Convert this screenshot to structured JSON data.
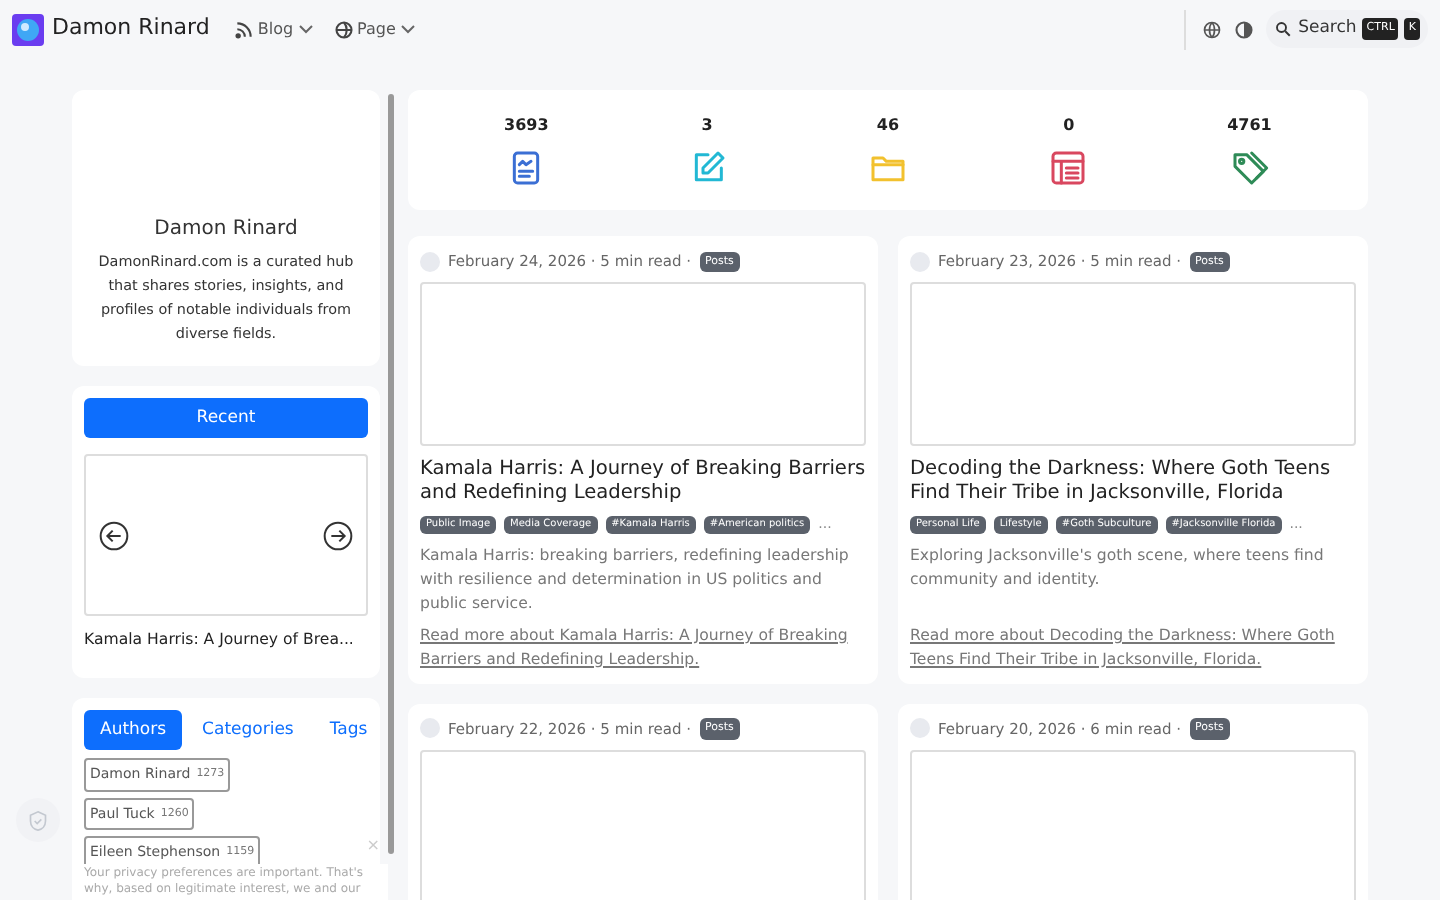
{
  "header": {
    "site_title": "Damon Rinard",
    "nav": [
      {
        "label": "Blog",
        "kind": "blog"
      },
      {
        "label": "Page",
        "kind": "page"
      }
    ],
    "search": {
      "label": "Search",
      "keys": [
        "CTRL",
        "K"
      ]
    }
  },
  "profile": {
    "name": "Damon Rinard",
    "description": "DamonRinard.com is a curated hub that shares stories, insights, and profiles of notable individuals from diverse fields."
  },
  "recent": {
    "button": "Recent",
    "slide_title": "Kamala Harris: A Journey of Brea..."
  },
  "taxonomy": {
    "tabs": [
      {
        "label": "Authors",
        "selected": true
      },
      {
        "label": "Categories",
        "selected": false
      },
      {
        "label": "Tags",
        "selected": false
      }
    ],
    "authors": [
      {
        "name": "Damon Rinard",
        "count": "1273"
      },
      {
        "name": "Paul Tuck",
        "count": "1260"
      },
      {
        "name": "Eileen Stephenson",
        "count": "1159"
      }
    ]
  },
  "privacy_notice": {
    "text": "Your privacy preferences are important. That's why, based on legitimate interest, we and our",
    "close": "×"
  },
  "stats": [
    {
      "value": "3693",
      "kind": "posts",
      "color": "#3b6fd4"
    },
    {
      "value": "3",
      "kind": "edit",
      "color": "#22b8d4"
    },
    {
      "value": "46",
      "kind": "folder",
      "color": "#f2c12e"
    },
    {
      "value": "0",
      "kind": "list",
      "color": "#d9475f"
    },
    {
      "value": "4761",
      "kind": "tags",
      "color": "#2e8b57"
    }
  ],
  "posts": [
    {
      "meta": "February 24, 2026 · 5 min read ·",
      "badge": "Posts",
      "title": "Kamala Harris: A Journey of Breaking Barriers and Redefining Leadership",
      "tags": [
        "Public Image",
        "Media Coverage",
        "#Kamala Harris",
        "#American politics"
      ],
      "more": "...",
      "excerpt": "Kamala Harris: breaking barriers, redefining leadership with resilience and determination in US politics and public service.",
      "link": "Read more about Kamala Harris: A Journey of Breaking Barriers and Redefining Leadership."
    },
    {
      "meta": "February 23, 2026 · 5 min read ·",
      "badge": "Posts",
      "title": "Decoding the Darkness: Where Goth Teens Find Their Tribe in Jacksonville, Florida",
      "tags": [
        "Personal Life",
        "Lifestyle",
        "#Goth Subculture",
        "#Jacksonville Florida"
      ],
      "more": "...",
      "excerpt": "Exploring Jacksonville's goth scene, where teens find community and identity.",
      "link": "Read more about Decoding the Darkness: Where Goth Teens Find Their Tribe in Jacksonville, Florida."
    },
    {
      "meta": "February 22, 2026 · 5 min read ·",
      "badge": "Posts"
    },
    {
      "meta": "February 20, 2026 · 6 min read ·",
      "badge": "Posts"
    }
  ]
}
